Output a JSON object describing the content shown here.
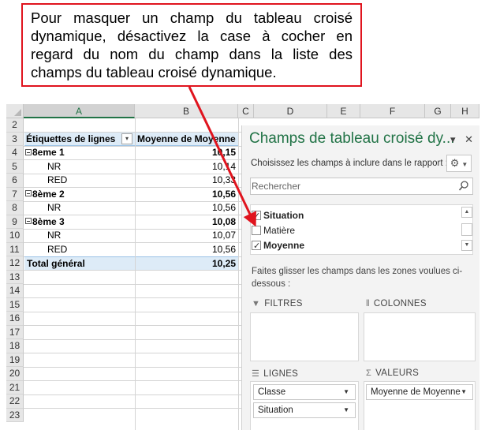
{
  "callout": {
    "text": "Pour masquer un champ du tableau croisé dynamique, désactivez la case à cocher en regard du nom du champ dans la liste des champs du tableau croisé dynamique."
  },
  "sheet": {
    "columns": [
      "A",
      "B",
      "C",
      "D",
      "E",
      "F",
      "G",
      "H"
    ],
    "rows": [
      "2",
      "3",
      "4",
      "5",
      "6",
      "7",
      "8",
      "9",
      "10",
      "11",
      "12",
      "13",
      "14",
      "15",
      "16",
      "17",
      "18",
      "19",
      "20",
      "21",
      "22",
      "23"
    ],
    "pivot": {
      "header_a": "Étiquettes de lignes",
      "header_b": "Moyenne de Moyenne",
      "lines": [
        {
          "label": "8eme 1",
          "value": "10,15",
          "bold": true
        },
        {
          "label": "NR",
          "value": "10,14",
          "bold": false
        },
        {
          "label": "RED",
          "value": "10,33",
          "bold": false
        },
        {
          "label": "8ème 2",
          "value": "10,56",
          "bold": true
        },
        {
          "label": "NR",
          "value": "10,56",
          "bold": false
        },
        {
          "label": "8ème 3",
          "value": "10,08",
          "bold": true
        },
        {
          "label": "NR",
          "value": "10,07",
          "bold": false
        },
        {
          "label": "RED",
          "value": "10,56",
          "bold": false
        }
      ],
      "total_label": "Total général",
      "total_value": "10,25"
    }
  },
  "panel": {
    "title": "Champs de tableau croisé dy...",
    "dropdown_glyph": "▾",
    "close_glyph": "✕",
    "subtitle": "Choisissez les champs à inclure dans le rapport :",
    "search_placeholder": "Rechercher",
    "fields": [
      {
        "name": "Situation",
        "checked": true,
        "bold": true
      },
      {
        "name": "Matière",
        "checked": false,
        "bold": false
      },
      {
        "name": "Moyenne",
        "checked": true,
        "bold": true
      }
    ],
    "hint": "Faites glisser les champs dans les zones voulues ci-dessous :",
    "zones": {
      "filters": "FILTRES",
      "columns": "COLONNES",
      "rows": "LIGNES",
      "values": "VALEURS"
    },
    "row_items": [
      "Classe",
      "Situation"
    ],
    "value_items": [
      "Moyenne de Moyenne"
    ]
  },
  "colors": {
    "accent": "#217346",
    "callout_border": "#e0141e",
    "arrow": "#e0141e",
    "pivot_header_bg": "#ddebf7"
  }
}
